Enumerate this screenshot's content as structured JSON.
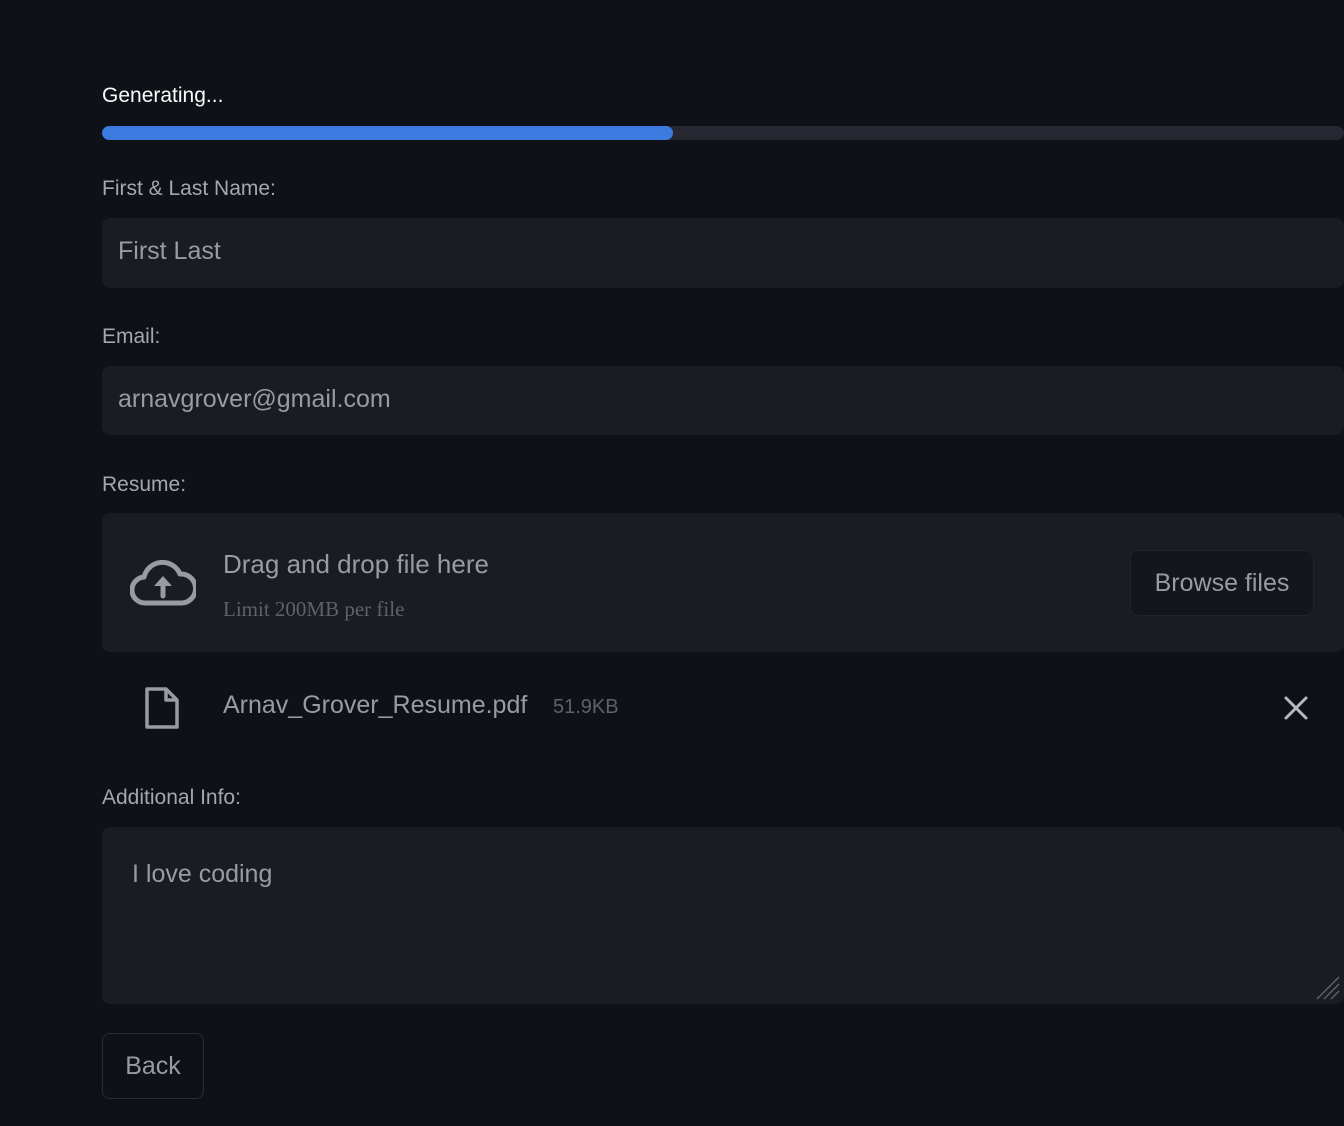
{
  "progress": {
    "label": "Generating...",
    "value": 0.46,
    "color": "#3b7be0"
  },
  "fields": {
    "name": {
      "label": "First & Last Name:",
      "value": "First Last"
    },
    "email": {
      "label": "Email:",
      "value": "arnavgrover@gmail.com"
    },
    "resume": {
      "label": "Resume:",
      "dropzone_title": "Drag and drop file here",
      "dropzone_limit": "Limit 200MB per file",
      "browse_label": "Browse files",
      "file": {
        "name": "Arnav_Grover_Resume.pdf",
        "size": "51.9KB"
      }
    },
    "additional": {
      "label": "Additional Info:",
      "value": "I love coding"
    }
  },
  "actions": {
    "back_label": "Back"
  },
  "icons": {
    "upload": "cloud-upload-icon",
    "file": "file-icon",
    "remove": "close-icon"
  }
}
